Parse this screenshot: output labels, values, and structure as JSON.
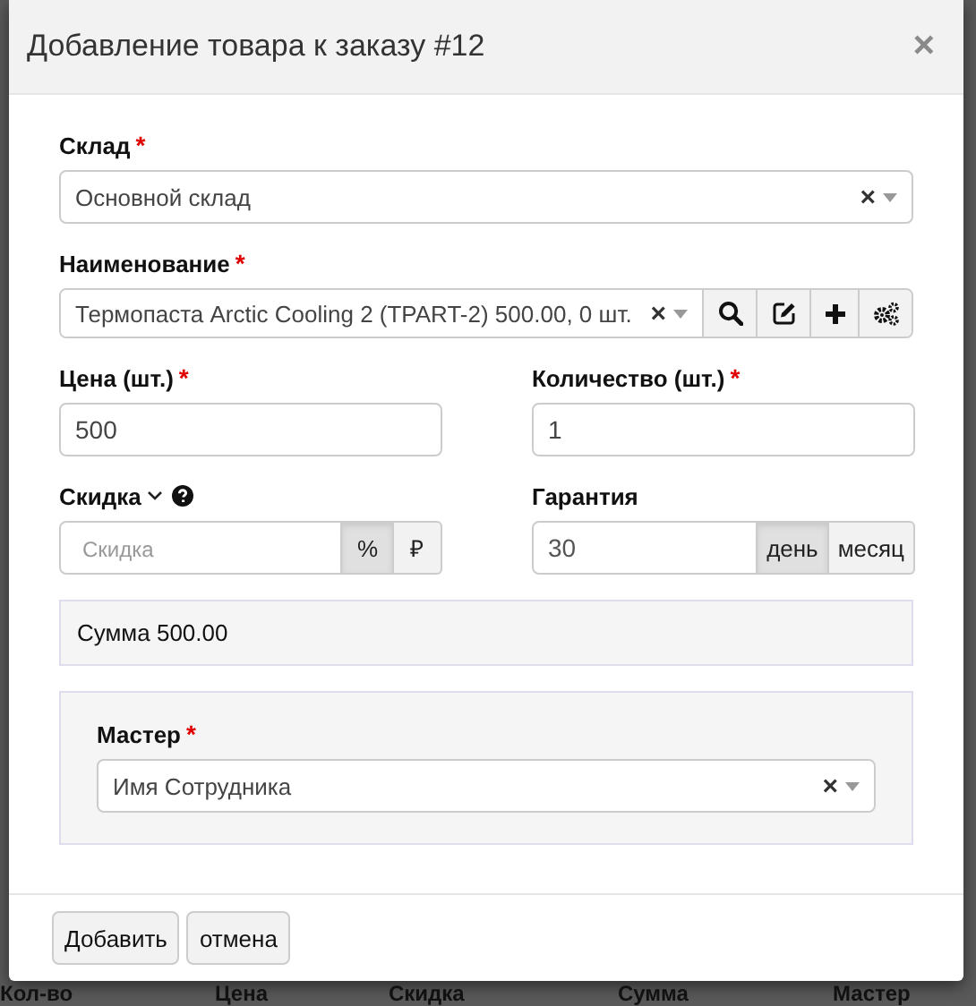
{
  "dialog": {
    "title": "Добавление товара к заказу #12",
    "close": "×"
  },
  "warehouse": {
    "label": "Склад",
    "required_mark": "*",
    "value": "Основной склад",
    "clear": "×"
  },
  "product": {
    "label": "Наименование",
    "required_mark": "*",
    "value": "Термопаста Arctic Cooling 2 (TPART-2) 500.00, 0 шт.",
    "clear": "×",
    "tools": [
      {
        "kind": "search"
      },
      {
        "kind": "edit"
      },
      {
        "kind": "add"
      },
      {
        "kind": "settings"
      }
    ]
  },
  "price": {
    "label": "Цена (шт.)",
    "required_mark": "*",
    "value": "500"
  },
  "quantity": {
    "label": "Количество (шт.)",
    "required_mark": "*",
    "value": "1"
  },
  "discount": {
    "label": "Скидка",
    "expandable": true,
    "help": true,
    "placeholder": "Скидка",
    "units": [
      {
        "label": "%",
        "selected": true
      },
      {
        "label": "₽",
        "selected": false
      }
    ]
  },
  "warranty": {
    "label": "Гарантия",
    "value": "30",
    "units": [
      {
        "label": "день",
        "selected": true
      },
      {
        "label": "месяц",
        "selected": false
      }
    ]
  },
  "total": "Сумма 500.00",
  "master": {
    "label": "Мастер",
    "required_mark": "*",
    "value": "Имя Сотрудника",
    "clear": "×"
  },
  "buttons": [
    "Добавить",
    "отмена"
  ],
  "background_table": {
    "columns": [
      "Кол-во",
      "Цена",
      "Скидка",
      "Сумма",
      "Мастер"
    ]
  }
}
